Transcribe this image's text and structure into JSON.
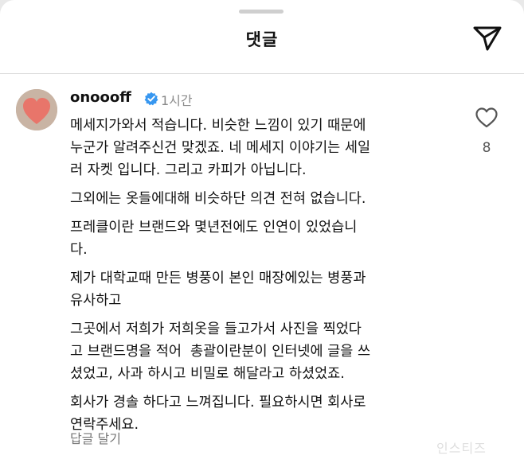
{
  "header": {
    "title": "댓글"
  },
  "comment": {
    "username": "onoooff",
    "time": "1시간",
    "paragraphs": [
      "메세지가와서 적습니다. 비슷한 느낌이 있기 때문에\n누군가 알려주신건 맞겠죠. 네 메세지 이야기는 세일\n러 자켓 입니다. 그리고 카피가 아닙니다.",
      "그외에는 옷들에대해 비슷하단 의견 전혀 없습니다.",
      "프레클이란 브랜드와 몇년전에도 인연이 있었습니\n다.",
      "제가 대학교때 만든 병풍이 본인 매장에있는 병풍과\n유사하고",
      "그곳에서 저희가 저희옷을 들고가서 사진을 찍었다\n고 브랜드명을 적어  총괄이란분이 인터넷에 글을 쓰\n셨었고, 사과 하시고 비밀로 해달라고 하셨었죠.",
      "회사가 경솔 하다고 느껴집니다. 필요하시면 회사로\n연락주세요."
    ],
    "like_count": "8",
    "reply_label": "답글 달기"
  },
  "watermark": "인스티즈",
  "colors": {
    "background": "#ffffff",
    "verified_badge": "#3797f0",
    "muted_text": "#8a8a8a"
  },
  "icons": {
    "send": "send-icon",
    "verified": "verified-badge-icon",
    "like": "heart-icon"
  }
}
